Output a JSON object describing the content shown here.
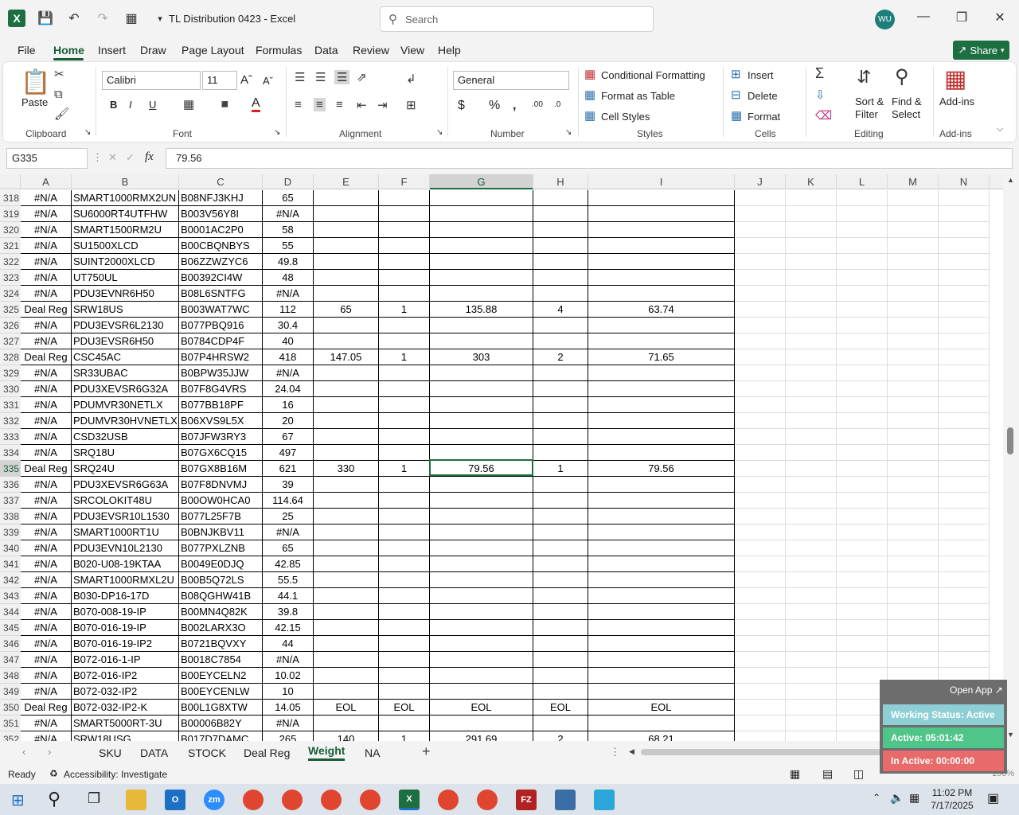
{
  "window": {
    "doc_title": "TL Distribution 0423  -  Excel",
    "search_placeholder": "Search",
    "user_initials": "WU"
  },
  "menu": {
    "tabs": [
      "File",
      "Home",
      "Insert",
      "Draw",
      "Page Layout",
      "Formulas",
      "Data",
      "Review",
      "View",
      "Help"
    ],
    "share_label": "Share"
  },
  "ribbon": {
    "paste_label": "Paste",
    "font_name": "Calibri",
    "font_size": "11",
    "number_format": "General",
    "cond_formatting": "Conditional Formatting",
    "format_table": "Format as Table",
    "cell_styles": "Cell Styles",
    "insert": "Insert",
    "delete": "Delete",
    "format": "Format",
    "sort_filter_1": "Sort &",
    "sort_filter_2": "Filter",
    "find_select_1": "Find &",
    "find_select_2": "Select",
    "addins": "Add-ins",
    "groups": [
      "Clipboard",
      "Font",
      "Alignment",
      "Number",
      "Styles",
      "Cells",
      "Editing",
      "Add-ins"
    ]
  },
  "formula_bar": {
    "name_box": "G335",
    "formula": "79.56"
  },
  "columns": [
    "A",
    "B",
    "C",
    "D",
    "E",
    "F",
    "G",
    "H",
    "I",
    "J",
    "K",
    "L",
    "M",
    "N"
  ],
  "rows": [
    {
      "n": "318",
      "a": "#N/A",
      "b": "SMART1000RMX2UN",
      "c": "B08NFJ3KHJ",
      "d": "65",
      "e": "",
      "f": "",
      "g": "",
      "h": "",
      "i": ""
    },
    {
      "n": "319",
      "a": "#N/A",
      "b": "SU6000RT4UTFHW",
      "c": "B003V56Y8I",
      "d": "#N/A",
      "e": "",
      "f": "",
      "g": "",
      "h": "",
      "i": ""
    },
    {
      "n": "320",
      "a": "#N/A",
      "b": "SMART1500RM2U",
      "c": "B0001AC2P0",
      "d": "58",
      "e": "",
      "f": "",
      "g": "",
      "h": "",
      "i": ""
    },
    {
      "n": "321",
      "a": "#N/A",
      "b": "SU1500XLCD",
      "c": "B00CBQNBYS",
      "d": "55",
      "e": "",
      "f": "",
      "g": "",
      "h": "",
      "i": ""
    },
    {
      "n": "322",
      "a": "#N/A",
      "b": "SUINT2000XLCD",
      "c": "B06ZZWZYC6",
      "d": "49.8",
      "e": "",
      "f": "",
      "g": "",
      "h": "",
      "i": ""
    },
    {
      "n": "323",
      "a": "#N/A",
      "b": "UT750UL",
      "c": "B00392CI4W",
      "d": "48",
      "e": "",
      "f": "",
      "g": "",
      "h": "",
      "i": ""
    },
    {
      "n": "324",
      "a": "#N/A",
      "b": "PDU3EVNR6H50",
      "c": "B08L6SNTFG",
      "d": "#N/A",
      "e": "",
      "f": "",
      "g": "",
      "h": "",
      "i": ""
    },
    {
      "n": "325",
      "a": "Deal Reg",
      "b": "SRW18US",
      "c": "B003WAT7WC",
      "d": "112",
      "e": "65",
      "f": "1",
      "g": "135.88",
      "h": "4",
      "i": "63.74"
    },
    {
      "n": "326",
      "a": "#N/A",
      "b": "PDU3EVSR6L2130",
      "c": "B077PBQ916",
      "d": "30.4",
      "e": "",
      "f": "",
      "g": "",
      "h": "",
      "i": ""
    },
    {
      "n": "327",
      "a": "#N/A",
      "b": "PDU3EVSR6H50",
      "c": "B0784CDP4F",
      "d": "40",
      "e": "",
      "f": "",
      "g": "",
      "h": "",
      "i": ""
    },
    {
      "n": "328",
      "a": "Deal Reg",
      "b": "CSC45AC",
      "c": "B07P4HRSW2",
      "d": "418",
      "e": "147.05",
      "f": "1",
      "g": "303",
      "h": "2",
      "i": "71.65"
    },
    {
      "n": "329",
      "a": "#N/A",
      "b": "SR33UBAC",
      "c": "B0BPW35JJW",
      "d": "#N/A",
      "e": "",
      "f": "",
      "g": "",
      "h": "",
      "i": ""
    },
    {
      "n": "330",
      "a": "#N/A",
      "b": "PDU3XEVSR6G32A",
      "c": "B07F8G4VRS",
      "d": "24.04",
      "e": "",
      "f": "",
      "g": "",
      "h": "",
      "i": ""
    },
    {
      "n": "331",
      "a": "#N/A",
      "b": "PDUMVR30NETLX",
      "c": "B077BB18PF",
      "d": "16",
      "e": "",
      "f": "",
      "g": "",
      "h": "",
      "i": ""
    },
    {
      "n": "332",
      "a": "#N/A",
      "b": "PDUMVR30HVNETLX",
      "c": "B06XVS9L5X",
      "d": "20",
      "e": "",
      "f": "",
      "g": "",
      "h": "",
      "i": ""
    },
    {
      "n": "333",
      "a": "#N/A",
      "b": "CSD32USB",
      "c": "B07JFW3RY3",
      "d": "67",
      "e": "",
      "f": "",
      "g": "",
      "h": "",
      "i": ""
    },
    {
      "n": "334",
      "a": "#N/A",
      "b": "SRQ18U",
      "c": "B07GX6CQ15",
      "d": "497",
      "e": "",
      "f": "",
      "g": "",
      "h": "",
      "i": ""
    },
    {
      "n": "335",
      "a": "Deal Reg",
      "b": "SRQ24U",
      "c": "B07GX8B16M",
      "d": "621",
      "e": "330",
      "f": "1",
      "g": "79.56",
      "h": "1",
      "i": "79.56"
    },
    {
      "n": "336",
      "a": "#N/A",
      "b": "PDU3XEVSR6G63A",
      "c": "B07F8DNVMJ",
      "d": "39",
      "e": "",
      "f": "",
      "g": "",
      "h": "",
      "i": ""
    },
    {
      "n": "337",
      "a": "#N/A",
      "b": "SRCOLOKIT48U",
      "c": "B00OW0HCA0",
      "d": "114.64",
      "e": "",
      "f": "",
      "g": "",
      "h": "",
      "i": ""
    },
    {
      "n": "338",
      "a": "#N/A",
      "b": "PDU3EVSR10L1530",
      "c": "B077L25F7B",
      "d": "25",
      "e": "",
      "f": "",
      "g": "",
      "h": "",
      "i": ""
    },
    {
      "n": "339",
      "a": "#N/A",
      "b": "SMART1000RT1U",
      "c": "B0BNJKBV11",
      "d": "#N/A",
      "e": "",
      "f": "",
      "g": "",
      "h": "",
      "i": ""
    },
    {
      "n": "340",
      "a": "#N/A",
      "b": "PDU3EVN10L2130",
      "c": "B077PXLZNB",
      "d": "65",
      "e": "",
      "f": "",
      "g": "",
      "h": "",
      "i": ""
    },
    {
      "n": "341",
      "a": "#N/A",
      "b": "B020-U08-19KTAA",
      "c": "B0049E0DJQ",
      "d": "42.85",
      "e": "",
      "f": "",
      "g": "",
      "h": "",
      "i": ""
    },
    {
      "n": "342",
      "a": "#N/A",
      "b": "SMART1000RMXL2U",
      "c": "B00B5Q72LS",
      "d": "55.5",
      "e": "",
      "f": "",
      "g": "",
      "h": "",
      "i": ""
    },
    {
      "n": "343",
      "a": "#N/A",
      "b": "B030-DP16-17D",
      "c": "B08QGHW41B",
      "d": "44.1",
      "e": "",
      "f": "",
      "g": "",
      "h": "",
      "i": ""
    },
    {
      "n": "344",
      "a": "#N/A",
      "b": "B070-008-19-IP",
      "c": "B00MN4Q82K",
      "d": "39.8",
      "e": "",
      "f": "",
      "g": "",
      "h": "",
      "i": ""
    },
    {
      "n": "345",
      "a": "#N/A",
      "b": "B070-016-19-IP",
      "c": "B002LARX3O",
      "d": "42.15",
      "e": "",
      "f": "",
      "g": "",
      "h": "",
      "i": ""
    },
    {
      "n": "346",
      "a": "#N/A",
      "b": "B070-016-19-IP2",
      "c": "B0721BQVXY",
      "d": "44",
      "e": "",
      "f": "",
      "g": "",
      "h": "",
      "i": ""
    },
    {
      "n": "347",
      "a": "#N/A",
      "b": "B072-016-1-IP",
      "c": "B0018C7854",
      "d": "#N/A",
      "e": "",
      "f": "",
      "g": "",
      "h": "",
      "i": ""
    },
    {
      "n": "348",
      "a": "#N/A",
      "b": "B072-016-IP2",
      "c": "B00EYCELN2",
      "d": "10.02",
      "e": "",
      "f": "",
      "g": "",
      "h": "",
      "i": ""
    },
    {
      "n": "349",
      "a": "#N/A",
      "b": "B072-032-IP2",
      "c": "B00EYCENLW",
      "d": "10",
      "e": "",
      "f": "",
      "g": "",
      "h": "",
      "i": ""
    },
    {
      "n": "350",
      "a": "Deal Reg",
      "b": "B072-032-IP2-K",
      "c": "B00L1G8XTW",
      "d": "14.05",
      "e": "EOL",
      "f": "EOL",
      "g": "EOL",
      "h": "EOL",
      "i": "EOL"
    },
    {
      "n": "351",
      "a": "#N/A",
      "b": "SMART5000RT-3U",
      "c": "B00006B82Y",
      "d": "#N/A",
      "e": "",
      "f": "",
      "g": "",
      "h": "",
      "i": ""
    },
    {
      "n": "352",
      "a": "#N/A",
      "b": "SRW18USG",
      "c": "B017D7DAMC",
      "d": "265",
      "e": "140",
      "f": "1",
      "g": "291.69",
      "h": "2",
      "i": "68.21"
    }
  ],
  "sheets": [
    "SKU",
    "DATA",
    "STOCK",
    "Deal Reg",
    "Weight",
    "NA"
  ],
  "active_sheet": "Weight",
  "status": {
    "ready": "Ready",
    "accessibility": "Accessibility: Investigate",
    "zoom": "100%"
  },
  "widget": {
    "open_app": "Open App ↗",
    "working_status": "Working Status: Active",
    "active": "Active: 05:01:42",
    "inactive": "In Active: 00:00:00"
  },
  "taskbar": {
    "time": "11:02 PM",
    "date": "7/17/2025"
  },
  "colors": {
    "excel_green": "#1d6f42",
    "accent_dark": "#185c37",
    "working_bar": "#8ecfd6",
    "active_bar": "#4fc58a",
    "inactive_bar": "#e86a6a"
  }
}
